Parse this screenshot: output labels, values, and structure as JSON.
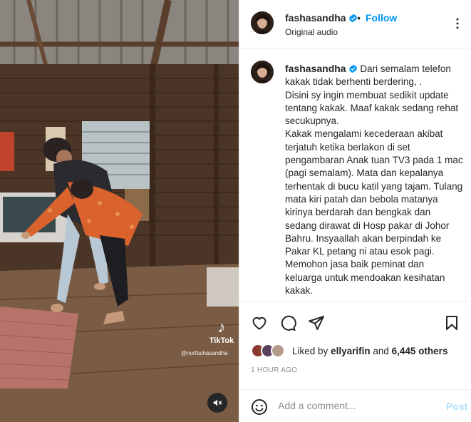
{
  "post": {
    "username": "fashasandha",
    "follow_label": "Follow",
    "separator": "•",
    "audio_label": "Original audio"
  },
  "caption": {
    "paragraphs": [
      "Dari semalam telefon kakak tidak berhenti berdering, .",
      "Disini sy ingin membuat sedikit update tentang kakak. Maaf kakak sedang rehat secukupnya.",
      "Kakak mengalami kecederaan akibat terjatuh ketika berlakon di set pengambaran Anak tuan TV3 pada 1 mac (pagi semalam). Mata dan kepalanya terhentak di bucu katil yang tajam. Tulang mata kiri patah dan bebola matanya kirinya berdarah dan bengkak dan sedang dirawat di Hosp pakar di Johor Bahru. Insyaallah akan berpindah ke Pakar KL petang ni atau esok pagi.",
      "Memohon jasa baik peminat dan keluarga untuk mendoakan kesihatan kakak."
    ]
  },
  "likes": {
    "prefix": "Liked by",
    "user": "ellyarifin",
    "middle": "and",
    "count": "6,445 others"
  },
  "timestamp": "1 HOUR AGO",
  "comment": {
    "placeholder": "Add a comment...",
    "post_label": "Post"
  },
  "video_overlay": {
    "brand": "TikTok",
    "handle": "@nurfashasandha"
  },
  "icons": {
    "verified": "verified-badge-icon",
    "more": "more-options-icon",
    "like": "heart-icon",
    "comment": "comment-icon",
    "share": "share-icon",
    "save": "bookmark-icon",
    "emoji": "emoji-icon",
    "mute": "muted-speaker-icon"
  },
  "colors": {
    "link_blue": "#0095f6",
    "post_disabled": "#b2dffc",
    "muted_text": "#8e8e8e",
    "border": "#efefef"
  }
}
